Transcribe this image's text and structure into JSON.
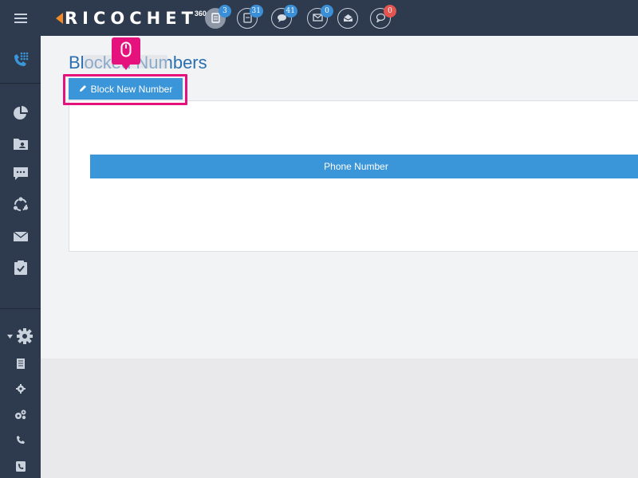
{
  "app": {
    "logo_text": "RICOCHET",
    "logo_suffix": "360"
  },
  "topbar": {
    "notifications": [
      {
        "icon": "document-icon",
        "count": "3",
        "badge_color": "#3b8fd6",
        "active": true
      },
      {
        "icon": "file-icon",
        "count": "31",
        "badge_color": "#3b8fd6",
        "active": false
      },
      {
        "icon": "chat-icon",
        "count": "41",
        "badge_color": "#3b8fd6",
        "active": false
      },
      {
        "icon": "mail-icon",
        "count": "0",
        "badge_color": "#3b8fd6",
        "active": false
      },
      {
        "icon": "open-mail-icon",
        "count": "",
        "badge_color": "",
        "active": false
      },
      {
        "icon": "comment-icon",
        "count": "0",
        "badge_color": "#e5554f",
        "active": false
      }
    ]
  },
  "sidebar": {
    "items": [
      {
        "icon": "phone-dialpad-icon"
      },
      {
        "icon": "pie-chart-icon"
      },
      {
        "icon": "contact-folder-icon"
      },
      {
        "icon": "message-icon"
      },
      {
        "icon": "network-icon"
      },
      {
        "icon": "envelope-icon"
      },
      {
        "icon": "checklist-icon"
      },
      {
        "icon": "settings-gear-icon"
      },
      {
        "icon": "report-icon"
      },
      {
        "icon": "gear-small-icon"
      },
      {
        "icon": "gears-icon"
      },
      {
        "icon": "phone-icon"
      },
      {
        "icon": "phone-book-icon"
      }
    ]
  },
  "main": {
    "page_title": "Blocked Numbers",
    "block_button_label": "Block New Number",
    "table": {
      "columns": [
        "Phone Number"
      ]
    }
  },
  "colors": {
    "topbar_bg": "#2e3b4e",
    "accent_blue": "#3b95d9",
    "title_blue": "#2a6fb0",
    "highlight_pink": "#e5127d",
    "logo_orange": "#f08a2b"
  }
}
